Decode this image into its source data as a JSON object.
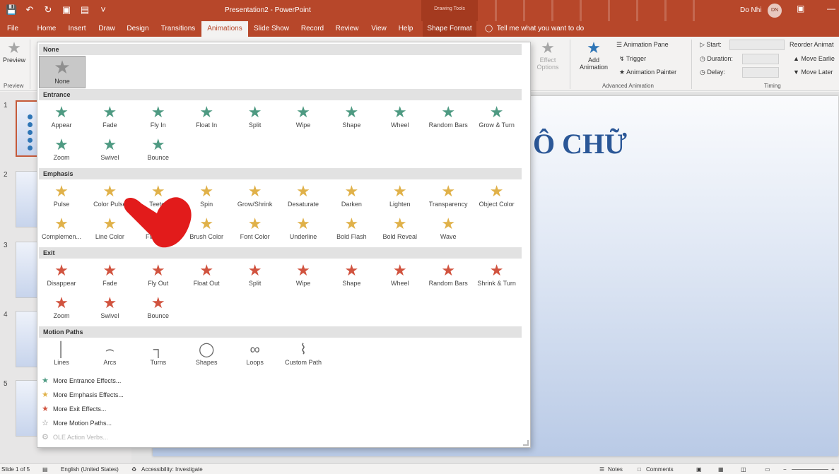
{
  "window": {
    "doc_title": "Presentation2  -  PowerPoint",
    "contextual_group": "Drawing Tools",
    "user_name": "Do Nhi",
    "user_initials": "DN"
  },
  "tabs": [
    "File",
    "Home",
    "Insert",
    "Draw",
    "Design",
    "Transitions",
    "Animations",
    "Slide Show",
    "Record",
    "Review",
    "View",
    "Help",
    "Shape Format"
  ],
  "active_tab": "Animations",
  "tell_me": "Tell me what you want to do",
  "ribbon": {
    "preview_label": "Preview",
    "preview_group": "Preview",
    "effect_options": "Effect Options",
    "add_animation": "Add Animation",
    "animation_pane": "Animation Pane",
    "trigger": "Trigger",
    "animation_painter": "Animation Painter",
    "advanced_group": "Advanced Animation",
    "start_label": "Start:",
    "duration_label": "Duration:",
    "delay_label": "Delay:",
    "timing_group": "Timing",
    "reorder": "Reorder Animat",
    "move_earlier": "Move Earlie",
    "move_later": "Move Later"
  },
  "gallery": {
    "none_section": "None",
    "none_item": "None",
    "entrance_section": "Entrance",
    "entrance": [
      "Appear",
      "Fade",
      "Fly In",
      "Float In",
      "Split",
      "Wipe",
      "Shape",
      "Wheel",
      "Random Bars",
      "Grow & Turn",
      "Zoom",
      "Swivel",
      "Bounce"
    ],
    "emphasis_section": "Emphasis",
    "emphasis": [
      "Pulse",
      "Color Pulse",
      "Teeter",
      "Spin",
      "Grow/Shrink",
      "Desaturate",
      "Darken",
      "Lighten",
      "Transparency",
      "Object Color",
      "Complemen...",
      "Line Color",
      "Fill Color",
      "Brush Color",
      "Font Color",
      "Underline",
      "Bold Flash",
      "Bold Reveal",
      "Wave"
    ],
    "exit_section": "Exit",
    "exit": [
      "Disappear",
      "Fade",
      "Fly Out",
      "Float Out",
      "Split",
      "Wipe",
      "Shape",
      "Wheel",
      "Random Bars",
      "Shrink & Turn",
      "Zoom",
      "Swivel",
      "Bounce"
    ],
    "paths_section": "Motion Paths",
    "paths": [
      "Lines",
      "Arcs",
      "Turns",
      "Shapes",
      "Loops",
      "Custom Path"
    ],
    "more": [
      "More Entrance Effects...",
      "More Emphasis Effects...",
      "More Exit Effects...",
      "More Motion Paths...",
      "OLE Action Verbs..."
    ]
  },
  "thumbnails": [
    "1",
    "2",
    "3",
    "4",
    "5"
  ],
  "slide": {
    "title_fragment": "Ô CHỮ"
  },
  "status": {
    "slide_info": "Slide 1 of 5",
    "language": "English (United States)",
    "accessibility": "Accessibility: Investigate",
    "notes": "Notes",
    "comments": "Comments"
  },
  "colors": {
    "accent": "#b7472a",
    "entrance": "#4e9a82",
    "emphasis": "#e0b149",
    "exit": "#d1533f"
  }
}
